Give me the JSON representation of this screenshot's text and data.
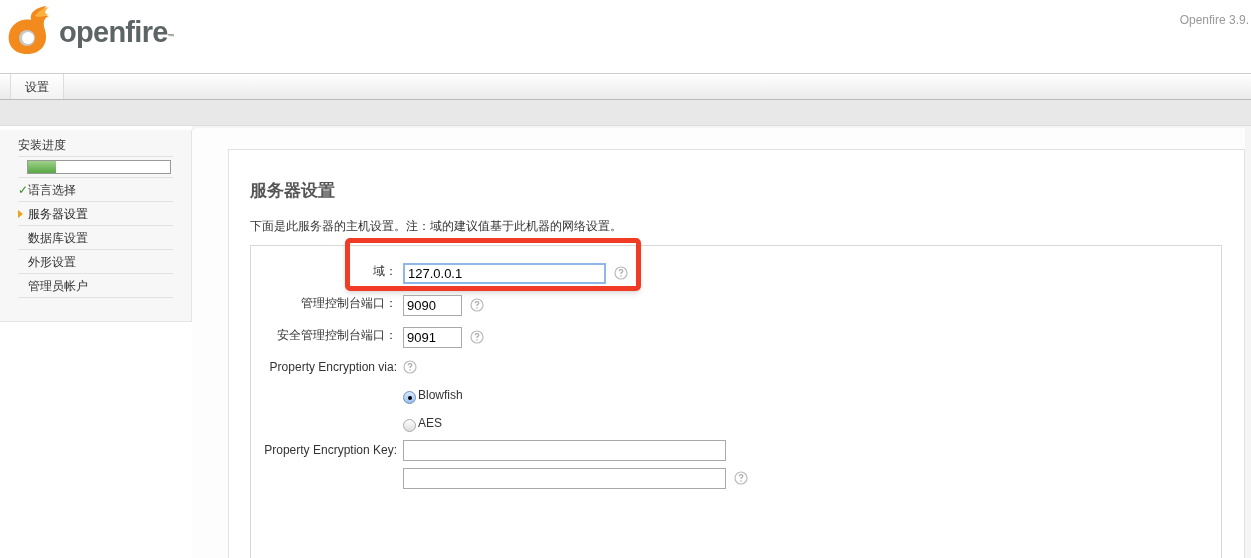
{
  "header": {
    "logo_text": "openfire",
    "trademark": "™",
    "version": "Openfire 3.9."
  },
  "tabs": [
    {
      "label": "设置",
      "selected": true
    }
  ],
  "sidebar": {
    "title": "安装进度",
    "progress": {
      "level": 0.2
    },
    "items": [
      {
        "label": "语言选择",
        "mark": "✓",
        "current": false
      },
      {
        "label": "服务器设置",
        "current": true
      },
      {
        "label": "数据库设置",
        "current": false
      },
      {
        "label": "外形设置",
        "current": false
      },
      {
        "label": "管理员帐户",
        "current": false
      }
    ]
  },
  "main": {
    "title": "服务器设置",
    "description": "下面是此服务器的主机设置。注：域的建议值基于此机器的网络设置。",
    "fields": [
      {
        "kind": "text",
        "label": "域：",
        "value": "127.0.0.1",
        "focused": true,
        "annotated": true
      },
      {
        "kind": "port",
        "label": "管理控制台端口：",
        "value": "9090",
        "focused": false,
        "annotated": false
      },
      {
        "kind": "port",
        "label": "安全管理控制台端口：",
        "value": "9091",
        "focused": false,
        "annotated": false
      },
      {
        "kind": "radio",
        "label": "Property Encryption via:",
        "options": [
          {
            "label": "Blowfish",
            "selected": true
          },
          {
            "label": "AES",
            "selected": false
          }
        ]
      },
      {
        "kind": "key",
        "label": "Property Encryption Key:",
        "inputs": [
          {
            "help": false
          },
          {
            "help": true
          }
        ]
      }
    ]
  }
}
